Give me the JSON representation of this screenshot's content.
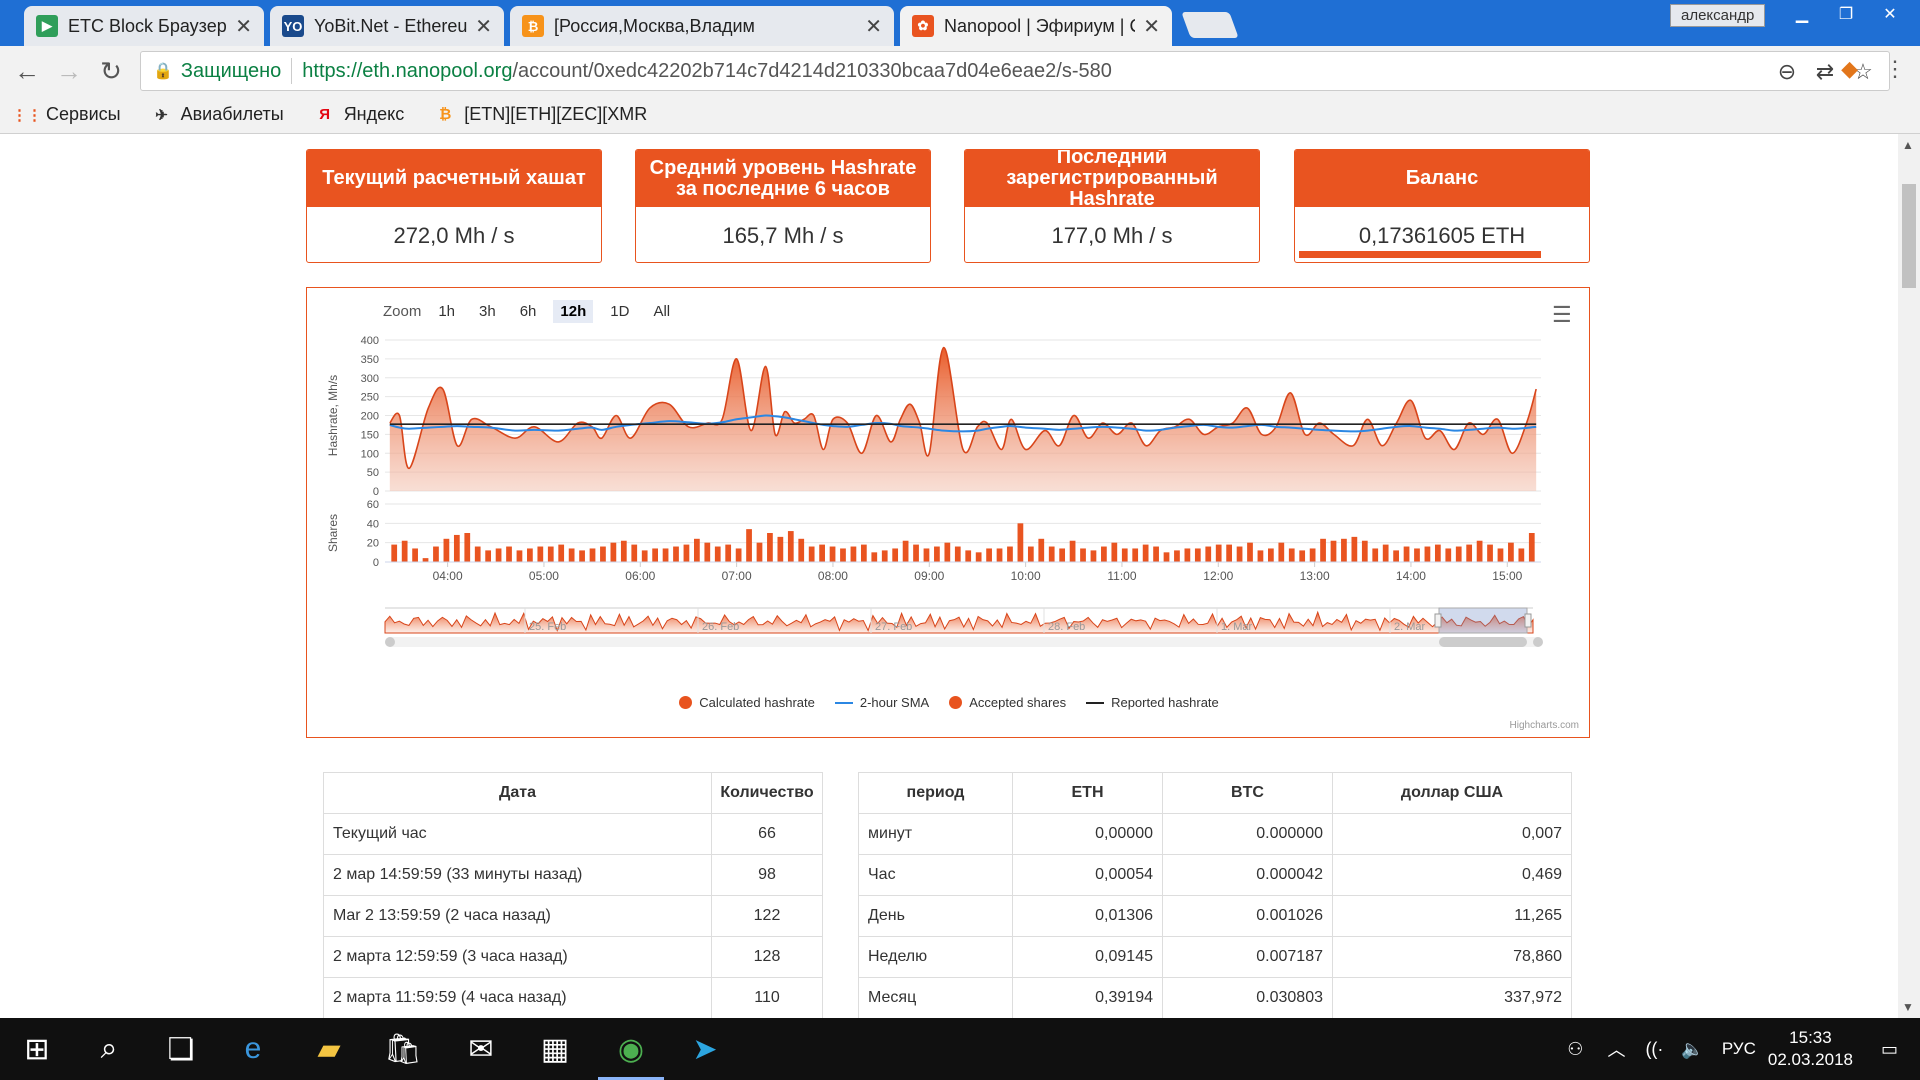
{
  "browser": {
    "tabs": [
      {
        "title": "ETC Block Браузер | Ethe",
        "icon": "etc-icon",
        "color": "#2f9e5a",
        "glyph": "▶"
      },
      {
        "title": "YoBit.Net - EthereumClas",
        "icon": "yobit-icon",
        "color": "#1a4a8c",
        "glyph": "YO"
      },
      {
        "title": "[Россия,Москва,Владим",
        "icon": "bitcoin-icon",
        "color": "#f7931a",
        "glyph": "₿"
      },
      {
        "title": "Nanopool | Эфириум | C",
        "icon": "nanopool-icon",
        "color": "#e95420",
        "glyph": "✿"
      }
    ],
    "user": "александр",
    "secure_label": "Защищено",
    "url_host": "https://eth.nanopool.org",
    "url_path": "/account/0xedc42202b714c7d4214d210330bcaa7d04e6eae2/s-580",
    "bookmarks": [
      {
        "label": "Сервисы",
        "icon": "apps-grid-icon"
      },
      {
        "label": "Авиабилеты",
        "icon": "airplane-icon"
      },
      {
        "label": "Яндекс",
        "icon": "yandex-icon"
      },
      {
        "label": "[ETN][ETH][ZEC][XMR",
        "icon": "bitcoin-icon"
      }
    ]
  },
  "cards": [
    {
      "title": "Текущий расчетный хашат",
      "value": "272,0 Mh / s"
    },
    {
      "title": "Средний уровень Hashrate за последние 6 часов",
      "value": "165,7 Mh / s"
    },
    {
      "title": "Последний зарегистрированный Hashrate",
      "value": "177,0 Mh / s"
    },
    {
      "title": "Баланс",
      "value": "0,17361605 ETH",
      "progress": 0.85
    }
  ],
  "chart": {
    "zoom_label": "Zoom",
    "zoom_buttons": [
      "1h",
      "3h",
      "6h",
      "12h",
      "1D",
      "All"
    ],
    "zoom_selected": "12h",
    "credits": "Highcharts.com",
    "legend": [
      "Calculated hashrate",
      "2-hour SMA",
      "Accepted shares",
      "Reported hashrate"
    ],
    "navigator_labels": [
      "25. Feb",
      "26. Feb",
      "27. Feb",
      "28. Feb",
      "1. Mar",
      "2. Mar"
    ]
  },
  "chart_data": {
    "type": "area",
    "x_ticks": [
      "04:00",
      "05:00",
      "06:00",
      "07:00",
      "08:00",
      "09:00",
      "10:00",
      "11:00",
      "12:00",
      "13:00",
      "14:00",
      "15:00"
    ],
    "hashrate": {
      "ylabel": "Hashrate, Mh/s",
      "ylim": [
        0,
        400
      ],
      "yticks": [
        0,
        50,
        100,
        150,
        200,
        250,
        300,
        350,
        400
      ],
      "x_hours": [
        3.4,
        3.5,
        3.6,
        3.8,
        3.95,
        4.1,
        4.25,
        4.45,
        4.7,
        4.9,
        5.15,
        5.35,
        5.5,
        5.6,
        5.75,
        5.9,
        6.1,
        6.3,
        6.5,
        6.7,
        6.85,
        7.0,
        7.15,
        7.3,
        7.4,
        7.5,
        7.6,
        7.7,
        7.8,
        7.9,
        8.0,
        8.15,
        8.3,
        8.45,
        8.6,
        8.7,
        8.8,
        8.9,
        9.0,
        9.15,
        9.35,
        9.5,
        9.6,
        9.75,
        9.85,
        10.0,
        10.2,
        10.35,
        10.5,
        10.65,
        10.8,
        10.95,
        11.1,
        11.25,
        11.4,
        11.55,
        11.7,
        11.85,
        12.0,
        12.15,
        12.3,
        12.45,
        12.6,
        12.75,
        12.9,
        13.05,
        13.2,
        13.4,
        13.55,
        13.7,
        13.85,
        14.0,
        14.15,
        14.3,
        14.45,
        14.6,
        14.75,
        14.9,
        15.05,
        15.2,
        15.3
      ],
      "calculated": [
        180,
        200,
        60,
        220,
        270,
        120,
        190,
        170,
        140,
        170,
        130,
        180,
        170,
        140,
        200,
        140,
        220,
        230,
        170,
        180,
        190,
        350,
        160,
        330,
        150,
        210,
        180,
        190,
        200,
        110,
        190,
        180,
        100,
        200,
        130,
        190,
        230,
        180,
        100,
        380,
        110,
        170,
        180,
        110,
        190,
        110,
        160,
        120,
        200,
        140,
        180,
        150,
        180,
        120,
        160,
        170,
        190,
        150,
        170,
        180,
        220,
        150,
        170,
        260,
        150,
        180,
        150,
        120,
        190,
        120,
        180,
        240,
        140,
        160,
        110,
        180,
        150,
        190,
        100,
        180,
        270
      ],
      "sma": [
        175,
        168,
        165,
        168,
        170,
        172,
        170,
        168,
        160,
        162,
        160,
        165,
        168,
        162,
        170,
        175,
        180,
        185,
        182,
        178,
        182,
        190,
        195,
        200,
        198,
        195,
        190,
        185,
        180,
        175,
        172,
        170,
        175,
        180,
        178,
        172,
        170,
        168,
        165,
        160,
        158,
        160,
        165,
        170,
        172,
        168,
        165,
        162,
        165,
        168,
        170,
        168,
        165,
        160,
        162,
        168,
        172,
        175,
        170,
        168,
        172,
        175,
        170,
        168,
        165,
        162,
        160,
        158,
        160,
        165,
        170,
        172,
        168,
        165,
        160,
        162,
        165,
        168,
        165,
        167,
        170
      ],
      "reported": 177
    },
    "shares": {
      "ylabel": "Shares",
      "ylim": [
        0,
        60
      ],
      "yticks": [
        0,
        20,
        40,
        60
      ],
      "values": [
        18,
        22,
        14,
        4,
        16,
        24,
        28,
        30,
        16,
        12,
        14,
        16,
        12,
        14,
        16,
        16,
        18,
        14,
        12,
        14,
        16,
        20,
        22,
        18,
        12,
        14,
        14,
        16,
        18,
        24,
        20,
        16,
        18,
        14,
        34,
        20,
        30,
        26,
        32,
        24,
        16,
        18,
        16,
        14,
        16,
        18,
        10,
        12,
        14,
        22,
        18,
        14,
        16,
        20,
        16,
        12,
        10,
        14,
        14,
        16,
        40,
        16,
        24,
        16,
        14,
        22,
        14,
        12,
        16,
        20,
        14,
        14,
        18,
        16,
        10,
        12,
        14,
        14,
        16,
        18,
        18,
        16,
        20,
        12,
        14,
        20,
        14,
        12,
        14,
        24,
        22,
        24,
        26,
        22,
        14,
        18,
        12,
        16,
        14,
        16,
        18,
        14,
        16,
        18,
        22,
        18,
        14,
        20,
        14,
        30
      ]
    }
  },
  "shares_table": {
    "headers": [
      "Дата",
      "Количество"
    ],
    "rows": [
      [
        "Текущий час",
        "66"
      ],
      [
        "2 мар 14:59:59 (33 минуты назад)",
        "98"
      ],
      [
        "Mar 2 13:59:59 (2 часа назад)",
        "122"
      ],
      [
        "2 марта 12:59:59 (3 часа назад)",
        "128"
      ],
      [
        "2 марта 11:59:59 (4 часа назад)",
        "110"
      ]
    ]
  },
  "earnings_table": {
    "headers": [
      "период",
      "ETH",
      "BTC",
      "доллар США"
    ],
    "rows": [
      [
        "минут",
        "0,00000",
        "0.000000",
        "0,007"
      ],
      [
        "Час",
        "0,00054",
        "0.000042",
        "0,469"
      ],
      [
        "День",
        "0,01306",
        "0.001026",
        "11,265"
      ],
      [
        "Неделю",
        "0,09145",
        "0.007187",
        "78,860"
      ],
      [
        "Месяц",
        "0,39194",
        "0.030803",
        "337,972"
      ]
    ]
  },
  "taskbar": {
    "time": "15:33",
    "date": "02.03.2018",
    "lang": "РУС"
  },
  "colors": {
    "accent": "#e95420",
    "sma": "#2b87e3",
    "reported": "#222222"
  }
}
